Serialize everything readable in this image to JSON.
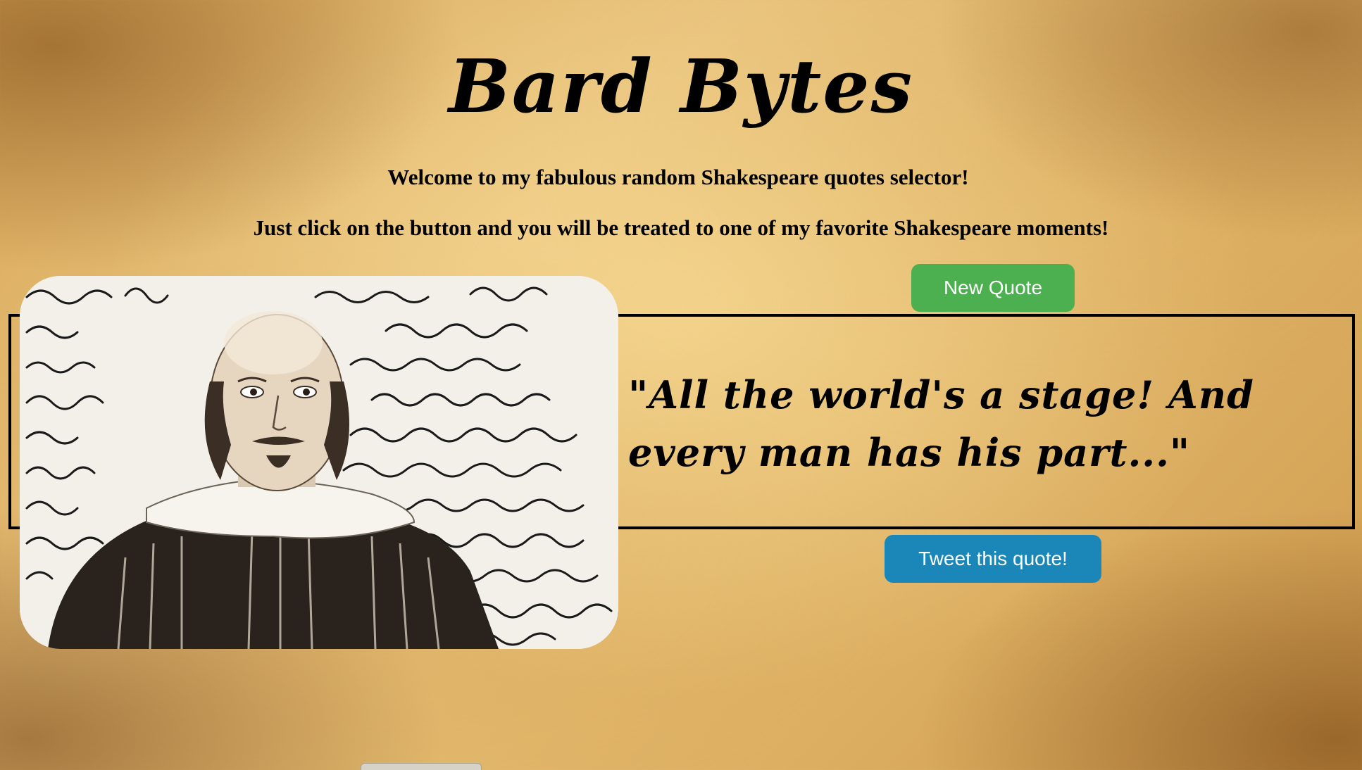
{
  "header": {
    "title": "Bard Bytes",
    "welcome_line1": "Welcome to my fabulous random Shakespeare quotes selector!",
    "welcome_line2": "Just click on the button and you will be treated to one of my favorite Shakespeare moments!"
  },
  "actions": {
    "new_quote_label": "New Quote",
    "tweet_label": "Tweet this quote!"
  },
  "quote": {
    "text": "\"All the world's a stage! And every man has his part...\""
  },
  "image": {
    "alt": "Portrait of William Shakespeare over handwritten manuscript"
  },
  "colors": {
    "new_quote_button": "#4caf50",
    "tweet_button": "#1a87b8",
    "text": "#000000"
  }
}
